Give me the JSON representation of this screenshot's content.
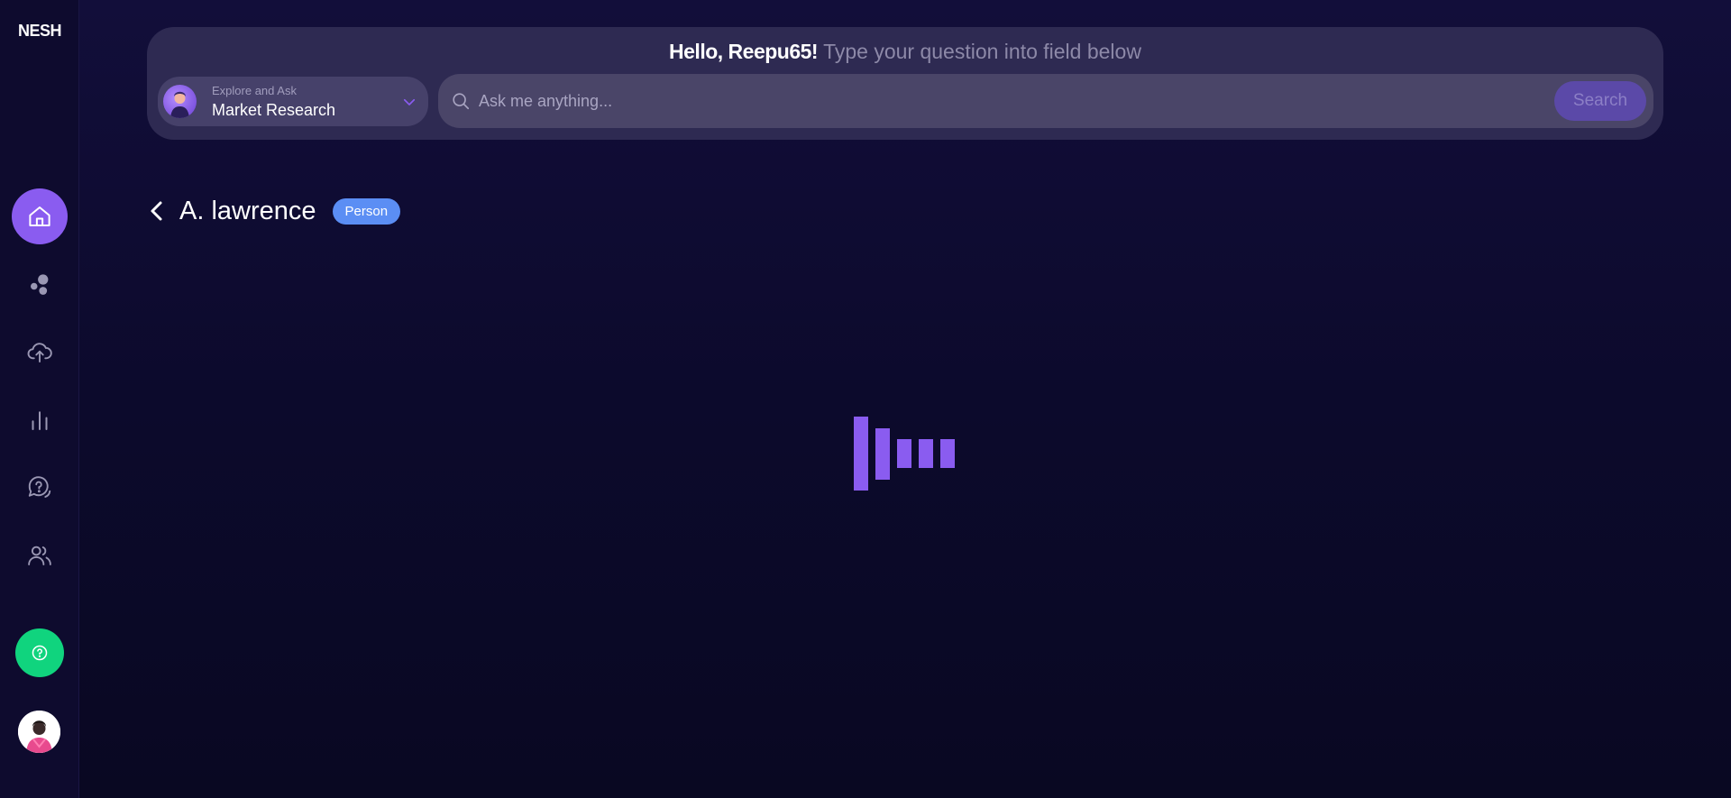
{
  "app": {
    "logo": "NESH"
  },
  "sidebar": {
    "items": [
      {
        "name": "home",
        "icon": "home-icon",
        "active": true
      },
      {
        "name": "clusters",
        "icon": "bubbles-icon",
        "active": false
      },
      {
        "name": "upload",
        "icon": "cloud-upload-icon",
        "active": false
      },
      {
        "name": "analytics",
        "icon": "bar-chart-icon",
        "active": false
      },
      {
        "name": "faq",
        "icon": "chat-question-icon",
        "active": false
      },
      {
        "name": "users",
        "icon": "users-icon",
        "active": false
      }
    ],
    "help_icon": "help-circle-icon",
    "help_color": "#10d47e",
    "accent": "#8a5cf0"
  },
  "header": {
    "greeting_bold": "Hello, Reepu65!",
    "greeting_rest": "Type your question into field below",
    "selector": {
      "caption": "Explore and Ask",
      "value": "Market Research"
    },
    "search": {
      "placeholder": "Ask me anything...",
      "button_label": "Search"
    }
  },
  "page": {
    "title": "A. lawrence",
    "badge": "Person",
    "badge_color": "#5b8ef4"
  },
  "loader": {
    "state": "loading",
    "color": "#8a5cf0"
  }
}
